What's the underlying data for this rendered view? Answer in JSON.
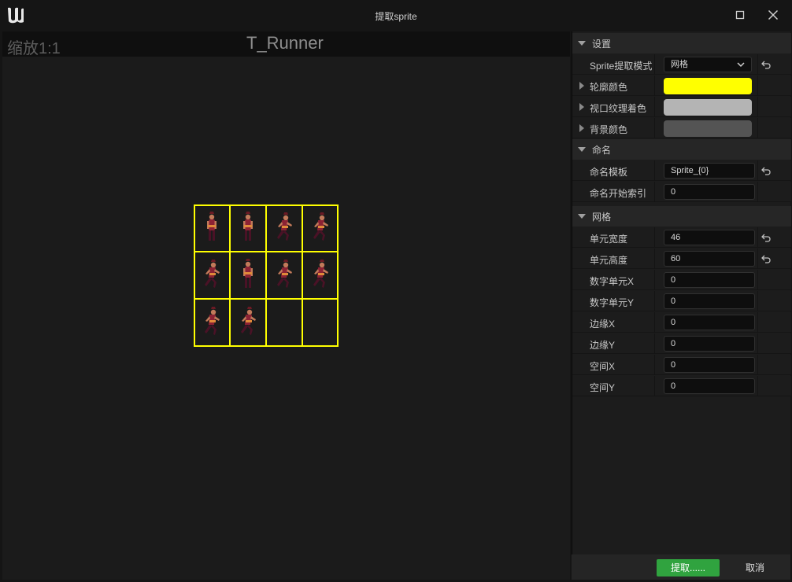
{
  "window": {
    "title": "提取sprite"
  },
  "viewport": {
    "zoom": "缩放1:1",
    "texture_name": "T_Runner",
    "grid_color": "#ffff00"
  },
  "sections": {
    "settings": {
      "label": "设置",
      "mode_label": "Sprite提取模式",
      "mode_value": "网格",
      "outline_color_label": "轮廓颜色",
      "outline_color": "#ffff00",
      "tint_label": "视口纹理着色",
      "tint_color": "#b4b4b4",
      "bg_color_label": "背景颜色",
      "bg_color": "#545454"
    },
    "naming": {
      "label": "命名",
      "template_label": "命名模板",
      "template_value": "Sprite_{0}",
      "start_index_label": "命名开始索引",
      "start_index_value": "0"
    },
    "grid": {
      "label": "网格",
      "cell_width_label": "单元宽度",
      "cell_width_value": "46",
      "cell_height_label": "单元高度",
      "cell_height_value": "60",
      "num_cells_x_label": "数字单元X",
      "num_cells_x_value": "0",
      "num_cells_y_label": "数字单元Y",
      "num_cells_y_value": "0",
      "margin_x_label": "边缘X",
      "margin_x_value": "0",
      "margin_y_label": "边缘Y",
      "margin_y_value": "0",
      "spacing_x_label": "空间X",
      "spacing_x_value": "0",
      "spacing_y_label": "空间Y",
      "spacing_y_value": "0"
    }
  },
  "footer": {
    "extract_label": "提取......",
    "cancel_label": "取消"
  },
  "icons": {
    "logo": "unreal-logo-icon",
    "maximize": "maximize-icon",
    "close": "close-icon",
    "reset": "reset-arrow-icon",
    "expand": "triangle-down-icon",
    "collapsed": "triangle-right-icon",
    "dropdown": "chevron-down-icon"
  }
}
